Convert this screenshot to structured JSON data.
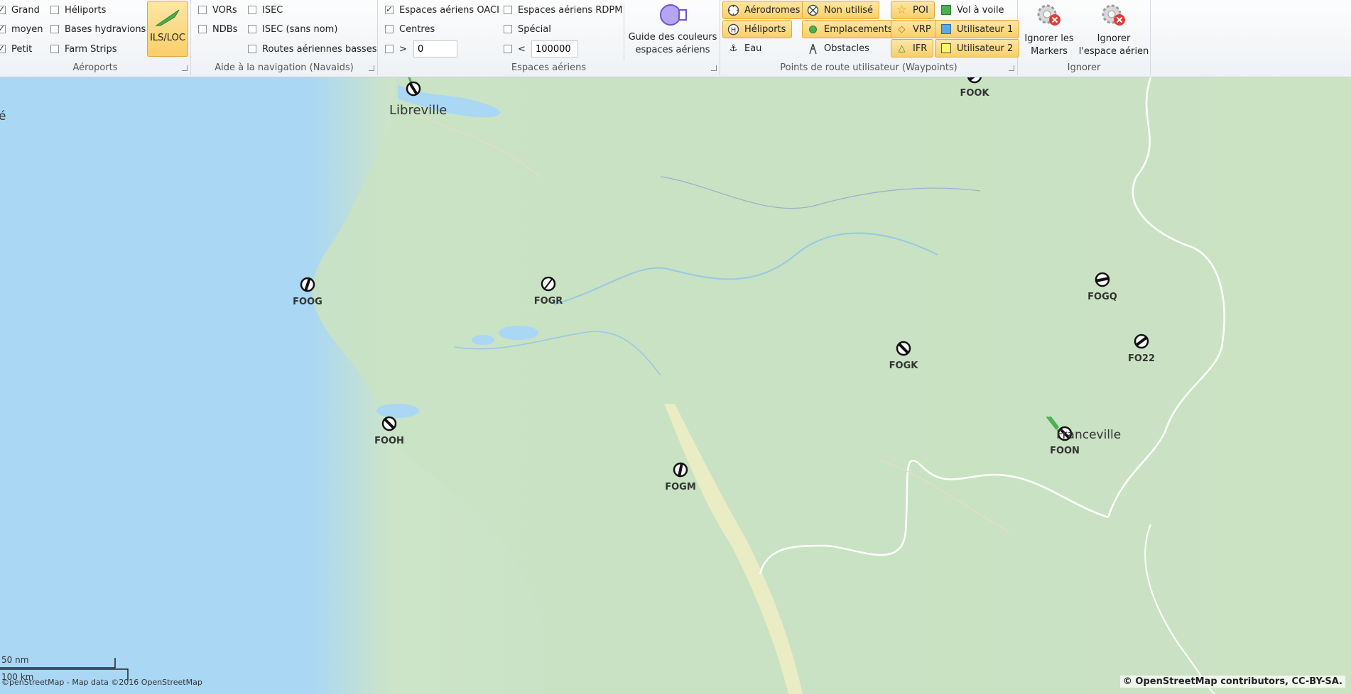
{
  "ribbon": {
    "airports": {
      "label": "Aéroports",
      "items": [
        {
          "label": "Grand",
          "checked": true
        },
        {
          "label": "moyen",
          "checked": true
        },
        {
          "label": "Petit",
          "checked": true
        },
        {
          "label": "Héliports",
          "checked": false
        },
        {
          "label": "Bases hydravions",
          "checked": false
        },
        {
          "label": "Farm Strips",
          "checked": false
        }
      ],
      "ils_label": "ILS/LOC"
    },
    "navaids": {
      "label": "Aide à la navigation (Navaids)",
      "items": [
        {
          "label": "VORs",
          "checked": false
        },
        {
          "label": "NDBs",
          "checked": false
        },
        {
          "label": "ISEC",
          "checked": false
        },
        {
          "label": "ISEC (sans nom)",
          "checked": false
        },
        {
          "label": "Routes aériennes basses",
          "checked": false
        }
      ]
    },
    "airspaces": {
      "label": "Espaces aériens",
      "items": [
        {
          "label": "Espaces aériens OACI",
          "checked": true
        },
        {
          "label": "Centres",
          "checked": false
        },
        {
          "label": ">",
          "checked": false
        },
        {
          "label": "Espaces aériens RDPM",
          "checked": false
        },
        {
          "label": "Spécial",
          "checked": false
        },
        {
          "label": "<",
          "checked": false
        }
      ],
      "min_value": "0",
      "max_value": "100000",
      "guide_label_1": "Guide des couleurs",
      "guide_label_2": "espaces aériens"
    },
    "waypoints": {
      "label": "Points de route utilisateur (Waypoints)",
      "buttons": [
        {
          "label": "Aérodromes",
          "active": true
        },
        {
          "label": "Héliports",
          "active": true
        },
        {
          "label": "Eau",
          "active": false
        },
        {
          "label": "Non utilisé",
          "active": true
        },
        {
          "label": "Emplacements",
          "active": true
        },
        {
          "label": "Obstacles",
          "active": false
        },
        {
          "label": "POI",
          "active": true
        },
        {
          "label": "VRP",
          "active": true
        },
        {
          "label": "IFR",
          "active": true
        },
        {
          "label": "Vol à voile",
          "active": false
        },
        {
          "label": "Utilisateur 1",
          "active": true
        },
        {
          "label": "Utilisateur 2",
          "active": true
        }
      ]
    },
    "ignore": {
      "label": "Ignorer",
      "markers_1": "Ignorer les",
      "markers_2": "Markers",
      "airspace_1": "Ignorer",
      "airspace_2": "l'espace aérien"
    }
  },
  "map": {
    "airports": [
      {
        "code": "FOOK"
      },
      {
        "code": "FOOG"
      },
      {
        "code": "FOGR"
      },
      {
        "code": "FOGQ"
      },
      {
        "code": "FOGK"
      },
      {
        "code": "FO22"
      },
      {
        "code": "FOOH"
      },
      {
        "code": "FOON"
      },
      {
        "code": "FOGM"
      }
    ],
    "cities": [
      {
        "name": "Libreville"
      },
      {
        "name": "Franceville"
      }
    ],
    "edge_text": "é",
    "scale_nm": "50 nm",
    "scale_km": "100 km",
    "map_credit": "©penStreetMap - Map data ©2016 OpenStreetMap",
    "attribution": "© OpenStreetMap contributors, CC-BY-SA."
  },
  "colors": {
    "accent": "#f9cf6a",
    "water": "#a9d7f4",
    "land": "#c6e0c0"
  }
}
